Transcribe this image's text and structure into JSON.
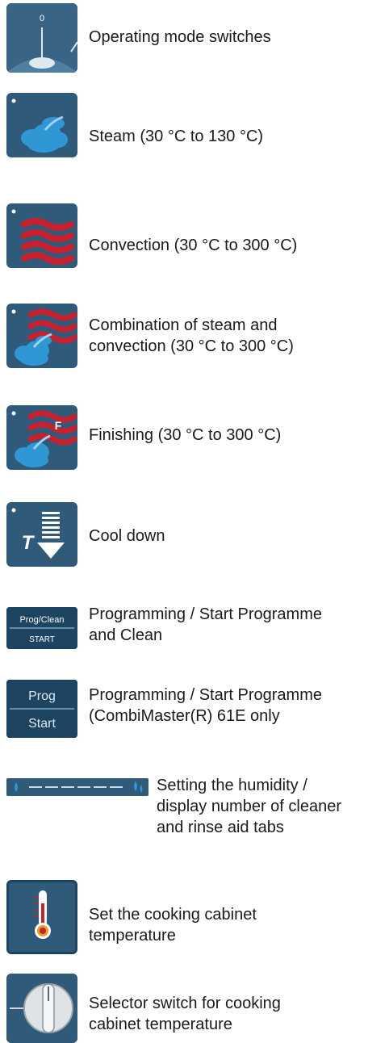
{
  "items": [
    {
      "icon": "operating-mode-switch-icon",
      "label": "Operating mode switches",
      "icon_text": "0"
    },
    {
      "icon": "steam-icon",
      "label": "Steam (30 °C to 130 °C)"
    },
    {
      "icon": "convection-icon",
      "label": "Convection (30 °C to 300 °C)"
    },
    {
      "icon": "combination-icon",
      "label": "Combination of steam and\nconvection (30 °C to 300 °C)"
    },
    {
      "icon": "finishing-icon",
      "label": "Finishing (30 °C to 300 °C)",
      "icon_text": "F"
    },
    {
      "icon": "cool-down-icon",
      "label": "Cool down",
      "icon_text": "T"
    },
    {
      "icon": "prog-clean-start-button-icon",
      "label": "Programming / Start Programme\nand Clean",
      "icon_top": "Prog/Clean",
      "icon_bottom": "START"
    },
    {
      "icon": "prog-start-button-icon",
      "label": "Programming / Start Programme\n(CombiMaster(R) 61E only",
      "icon_top": "Prog",
      "icon_bottom": "Start"
    },
    {
      "icon": "humidity-bar-icon",
      "label": "Setting the humidity /\ndisplay number of cleaner\nand rinse aid tabs"
    },
    {
      "icon": "thermometer-icon",
      "label": "Set the cooking cabinet\ntemperature"
    },
    {
      "icon": "selector-knob-icon",
      "label": "Selector switch for cooking\ncabinet temperature"
    }
  ],
  "colors": {
    "icon_bg": "#2f5a7a",
    "steam": "#2f97d4",
    "convection": "#c8202e",
    "button_bg": "#1d4461"
  }
}
